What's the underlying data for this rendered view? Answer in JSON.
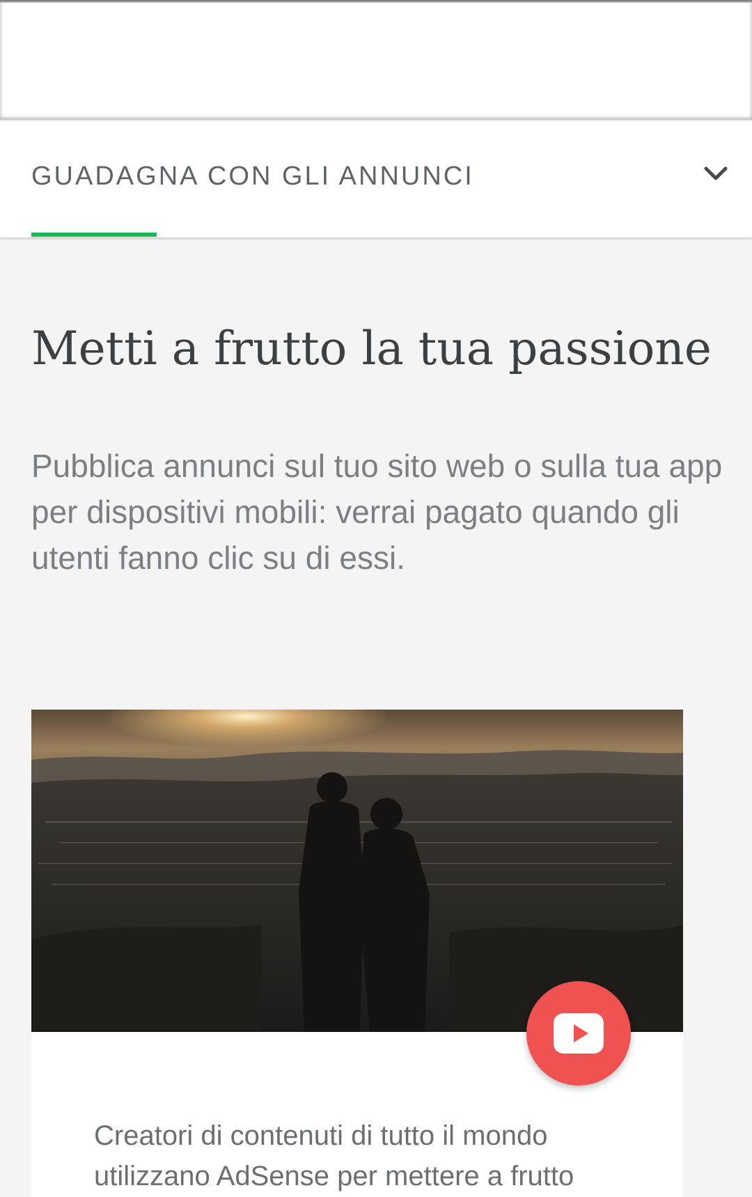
{
  "subnav": {
    "label": "GUADAGNA CON GLI ANNUNCI",
    "expand_icon": "chevron-down-icon"
  },
  "hero": {
    "headline": "Metti a frutto la tua passione",
    "description": "Pubblica annunci sul tuo sito web o sulla tua app per dispositivi mobili: verrai pagato quando gli utenti fanno clic su di essi."
  },
  "video": {
    "play_icon": "play-icon",
    "caption": "Creatori di contenuti di tutto il mondo utilizzano AdSense per mettere a frutto"
  },
  "colors": {
    "accent": "#1db954",
    "play_button": "#f05151"
  }
}
